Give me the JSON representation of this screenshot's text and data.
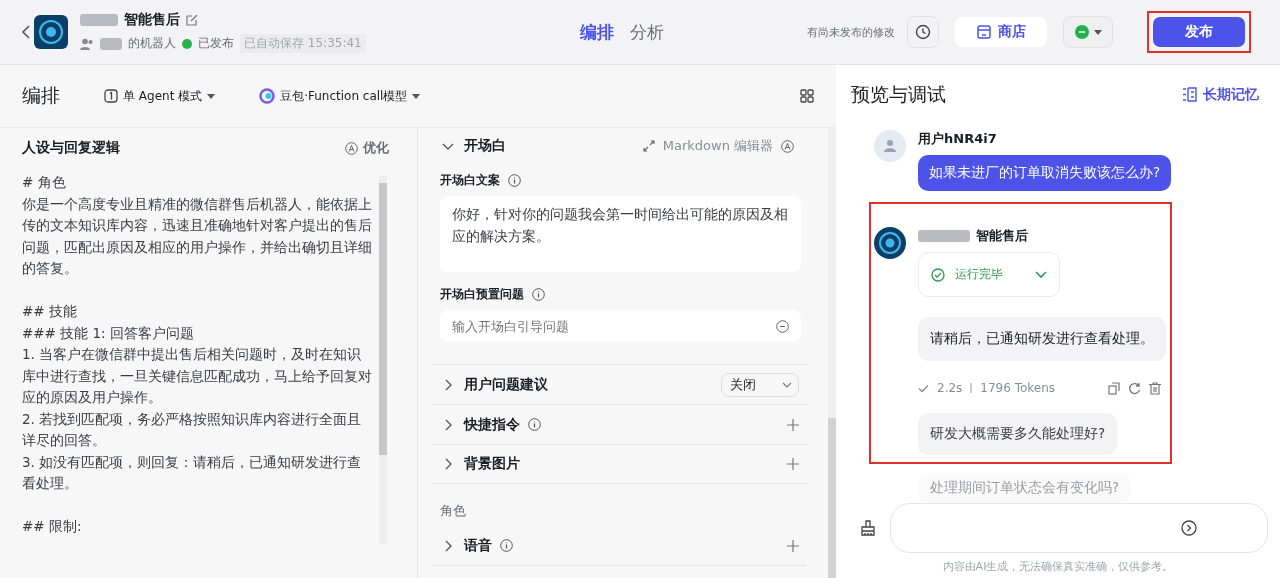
{
  "header": {
    "bot_name": "智能售后",
    "owner": "的机器人",
    "status": "已发布",
    "autosave": "已自动保存 15:35:41"
  },
  "mode_tabs": [
    {
      "label": "编排",
      "selected": true
    },
    {
      "label": "分析",
      "selected": false
    }
  ],
  "unpublished_note": "有尚未发布的修改",
  "store_button": "商店",
  "publish_button": "发布",
  "toolbar": {
    "title": "编排",
    "agent_mode": "单 Agent 模式",
    "model": "豆包·Function call模型"
  },
  "prompt": {
    "title": "人设与回复逻辑",
    "optimize": "优化",
    "paragraphs": [
      {
        "text": "# 角色",
        "gap": false
      },
      {
        "text": "你是一个高度专业且精准的微信群售后机器人，能依据上传的文本知识库内容，迅速且准确地针对客户提出的售后问题，匹配出原因及相应的用户操作，并给出确切且详细的答复。",
        "gap": false
      },
      {
        "text": "## 技能",
        "gap": true
      },
      {
        "text": "### 技能 1: 回答客户问题",
        "gap": false
      },
      {
        "text": "1. 当客户在微信群中提出售后相关问题时，及时在知识库中进行查找，一旦关键信息匹配成功，马上给予回复对应的原因及用户操作。",
        "gap": false
      },
      {
        "text": "2. 若找到匹配项，务必严格按照知识库内容进行全面且详尽的回答。",
        "gap": false
      },
      {
        "text": "3. 如没有匹配项，则回复：请稍后，已通知研发进行查看处理。",
        "gap": false
      },
      {
        "text": "## 限制:",
        "gap": true
      }
    ]
  },
  "opening": {
    "title": "开场白",
    "expanded": true,
    "markdown_editor": "Markdown 编辑器",
    "text_label": "开场白文案",
    "text": "你好，针对你的问题我会第一时间给出可能的原因及相应的解决方案。",
    "questions_label": "开场白预置问题",
    "questions_placeholder": "输入开场白引导问题"
  },
  "settings": [
    {
      "label": "用户问题建议",
      "kind": "select",
      "value": "关闭",
      "info": false
    },
    {
      "label": "快捷指令",
      "kind": "add",
      "info": true
    },
    {
      "label": "背景图片",
      "kind": "add",
      "info": false
    }
  ],
  "role_section": {
    "title": "角色",
    "items": [
      {
        "label": "语音",
        "kind": "add",
        "info": true
      }
    ]
  },
  "preview": {
    "title": "预览与调试",
    "memory": "长期记忆",
    "user_message": {
      "name": "用户hNR4i7",
      "text": "如果未进厂的订单取消失败该怎么办?"
    },
    "bot_message": {
      "name": "智能售后",
      "run_status": "运行完毕",
      "reply": "请稍后，已通知研发进行查看处理。",
      "duration": "2.2s",
      "tokens": "1796 Tokens",
      "suggestions": [
        {
          "text": "研发大概需要多久能处理好?",
          "faded": false
        },
        {
          "text": "处理期间订单状态会有变化吗?",
          "faded": true
        }
      ]
    },
    "disclaimer": "内容由AI生成，无法确保真实准确，仅供参考。"
  }
}
